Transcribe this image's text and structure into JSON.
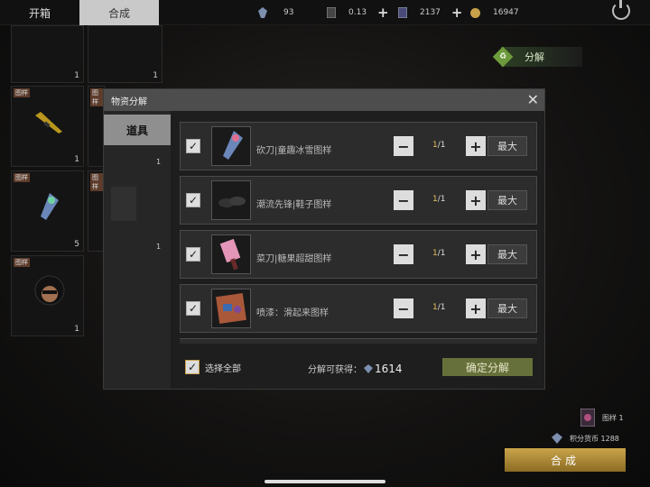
{
  "tabs": [
    {
      "label": "开箱"
    },
    {
      "label": "合成"
    }
  ],
  "currencies": [
    {
      "icon": "crystal-icon",
      "value": "93"
    },
    {
      "icon": "ticket-icon",
      "value": "0.13"
    },
    {
      "icon": "card-icon",
      "value": "2137"
    },
    {
      "icon": "coin-icon",
      "value": "16947"
    }
  ],
  "inventory": [
    {
      "tag": "",
      "count": "1"
    },
    {
      "tag": "",
      "count": "1"
    },
    {
      "tag": "图样",
      "count": "1"
    },
    {
      "tag": "图样",
      "count": ""
    },
    {
      "tag": "图样",
      "count": "5"
    },
    {
      "tag": "图样",
      "count": ""
    },
    {
      "tag": "图样",
      "count": "1"
    }
  ],
  "decompose_button": "分解",
  "modal": {
    "title": "物资分解",
    "side_tab": "道具",
    "side_counts": [
      "1",
      "1"
    ],
    "rows": [
      {
        "name": "砍刀|童趣冰雪图样",
        "qty": "1",
        "total": "/1",
        "max": "最大"
      },
      {
        "name": "潮流先锋|鞋子图样",
        "qty": "1",
        "total": "/1",
        "max": "最大"
      },
      {
        "name": "菜刀|糖果超甜图样",
        "qty": "1",
        "total": "/1",
        "max": "最大"
      },
      {
        "name": "喷漆：滑起来图样",
        "qty": "1",
        "total": "/1",
        "max": "最大"
      }
    ],
    "select_all": "选择全部",
    "obtain_label": "分解可获得：",
    "obtain_value": "1614",
    "confirm": "确定分解"
  },
  "summary": {
    "pattern": "图样 1",
    "points": "积分货币 1288"
  },
  "compose_button": "合成",
  "colors": {
    "accent_gold": "#e7c05a",
    "confirm_green": "#66703a",
    "tag_brown": "#5d3c2b"
  }
}
